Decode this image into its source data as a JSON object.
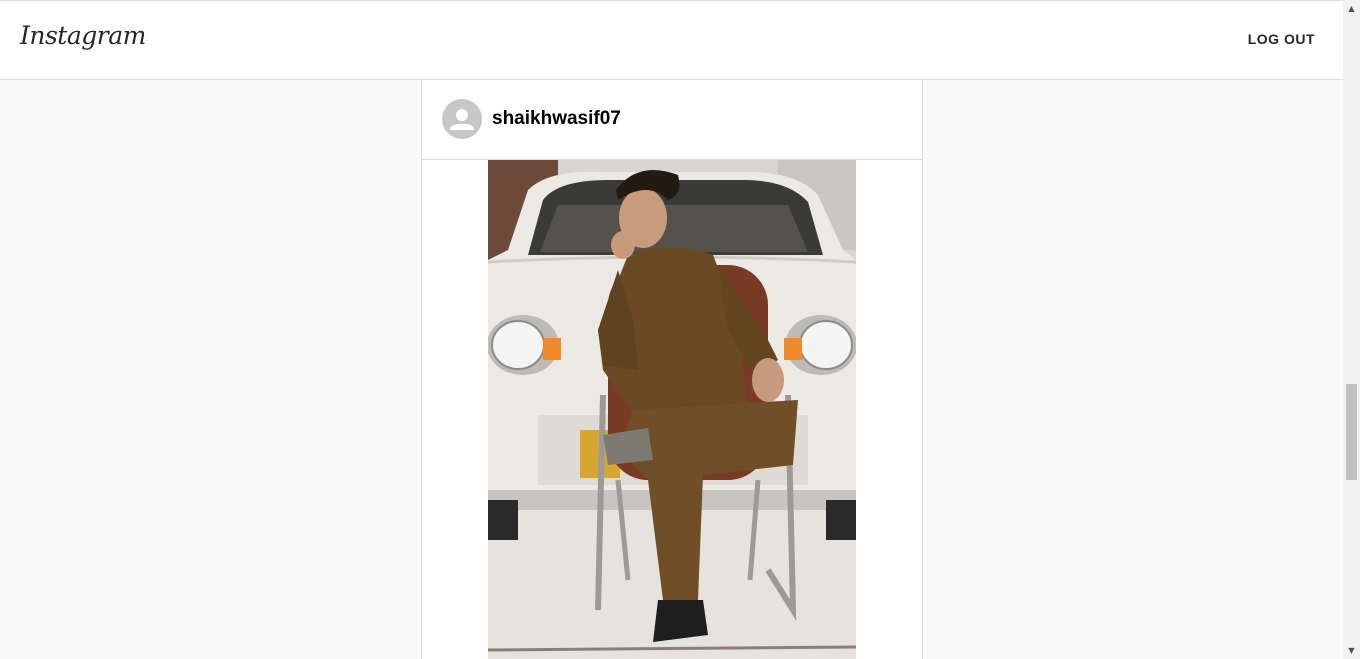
{
  "header": {
    "logo_text": "Instagram",
    "logout_label": "LOG OUT"
  },
  "post": {
    "username": "shaikhwasif07",
    "avatar_icon": "default-user-icon",
    "photo_description_icon": "post-photo"
  },
  "colors": {
    "border": "#dbdbdb",
    "background": "#fafafa",
    "text": "#262626"
  }
}
